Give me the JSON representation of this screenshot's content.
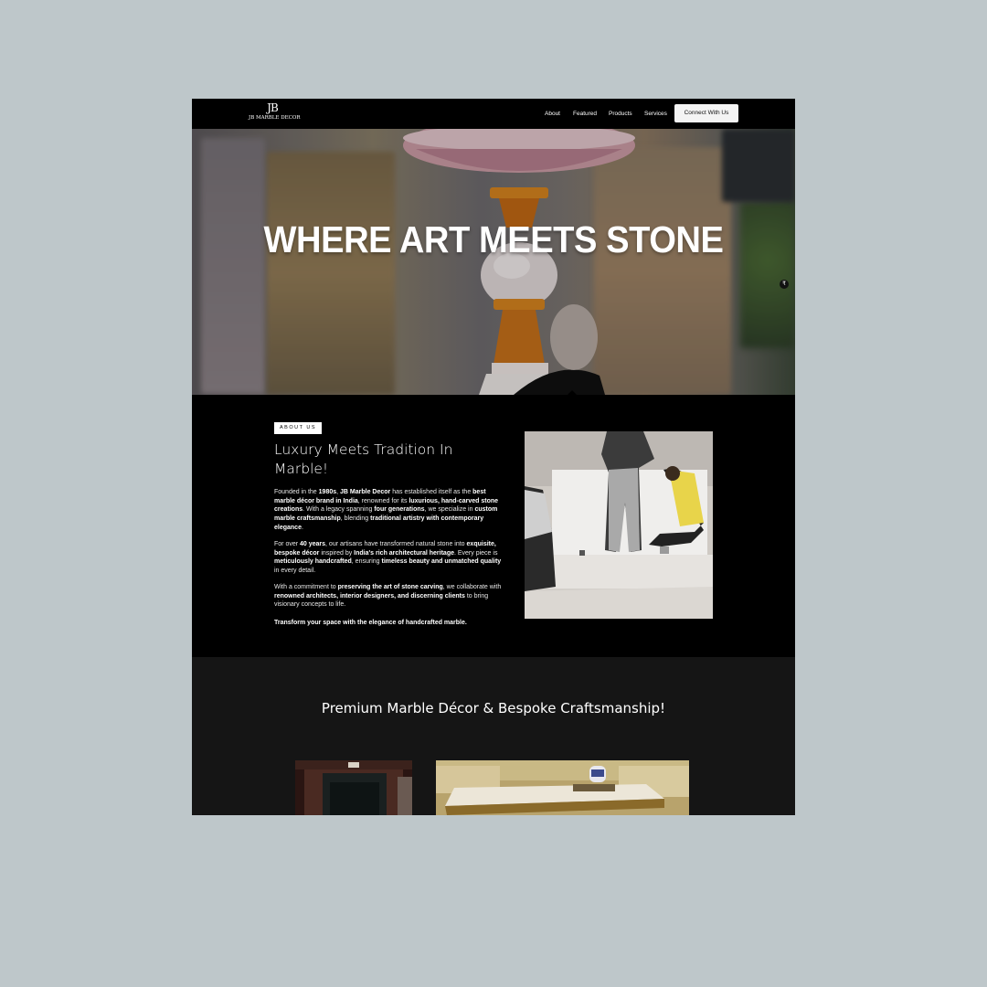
{
  "brand": {
    "monogram": "JB",
    "name": "JB MARBLE DECOR"
  },
  "nav": {
    "links": [
      "About",
      "Featured",
      "Products",
      "Services"
    ],
    "cta": "Connect With Us"
  },
  "hero": {
    "title": "WHERE ART MEETS STONE",
    "badge": "₹"
  },
  "about": {
    "tag": "ABOUT US",
    "heading": "Luxury Meets Tradition In Marble!",
    "paragraphs": [
      [
        {
          "t": "Founded in the ",
          "b": false
        },
        {
          "t": "1980s",
          "b": true
        },
        {
          "t": ", ",
          "b": false
        },
        {
          "t": "JB Marble Decor",
          "b": true
        },
        {
          "t": " has established itself as the ",
          "b": false
        },
        {
          "t": "best marble décor brand in India",
          "b": true
        },
        {
          "t": ", renowned for its ",
          "b": false
        },
        {
          "t": "luxurious, hand-carved stone creations",
          "b": true
        },
        {
          "t": ". With a legacy spanning ",
          "b": false
        },
        {
          "t": "four generations",
          "b": true
        },
        {
          "t": ", we specialize in ",
          "b": false
        },
        {
          "t": "custom marble craftsmanship",
          "b": true
        },
        {
          "t": ", blending ",
          "b": false
        },
        {
          "t": "traditional artistry with contemporary elegance",
          "b": true
        },
        {
          "t": ".",
          "b": false
        }
      ],
      [
        {
          "t": "For over ",
          "b": false
        },
        {
          "t": "40 years",
          "b": true
        },
        {
          "t": ", our artisans have transformed natural stone into ",
          "b": false
        },
        {
          "t": "exquisite, bespoke décor",
          "b": true
        },
        {
          "t": " inspired by ",
          "b": false
        },
        {
          "t": "India's rich architectural heritage",
          "b": true
        },
        {
          "t": ". Every piece is ",
          "b": false
        },
        {
          "t": "meticulously handcrafted",
          "b": true
        },
        {
          "t": ", ensuring ",
          "b": false
        },
        {
          "t": "timeless beauty and unmatched quality",
          "b": true
        },
        {
          "t": " in every detail.",
          "b": false
        }
      ],
      [
        {
          "t": "With a commitment to ",
          "b": false
        },
        {
          "t": "preserving the art of stone carving",
          "b": true
        },
        {
          "t": ", we collaborate with ",
          "b": false
        },
        {
          "t": "renowned architects, interior designers, and discerning clients",
          "b": true
        },
        {
          "t": " to bring visionary concepts to life.",
          "b": false
        }
      ],
      [
        {
          "t": "Transform your space with the elegance of handcrafted marble.",
          "b": true
        }
      ]
    ]
  },
  "premium": {
    "title": "Premium Marble Décor & Bespoke Craftsmanship!"
  },
  "colors": {
    "page_bg": "#bec7ca",
    "site_bg": "#000000",
    "section_bg": "#151515",
    "cta_bg": "#f4f4f4"
  }
}
